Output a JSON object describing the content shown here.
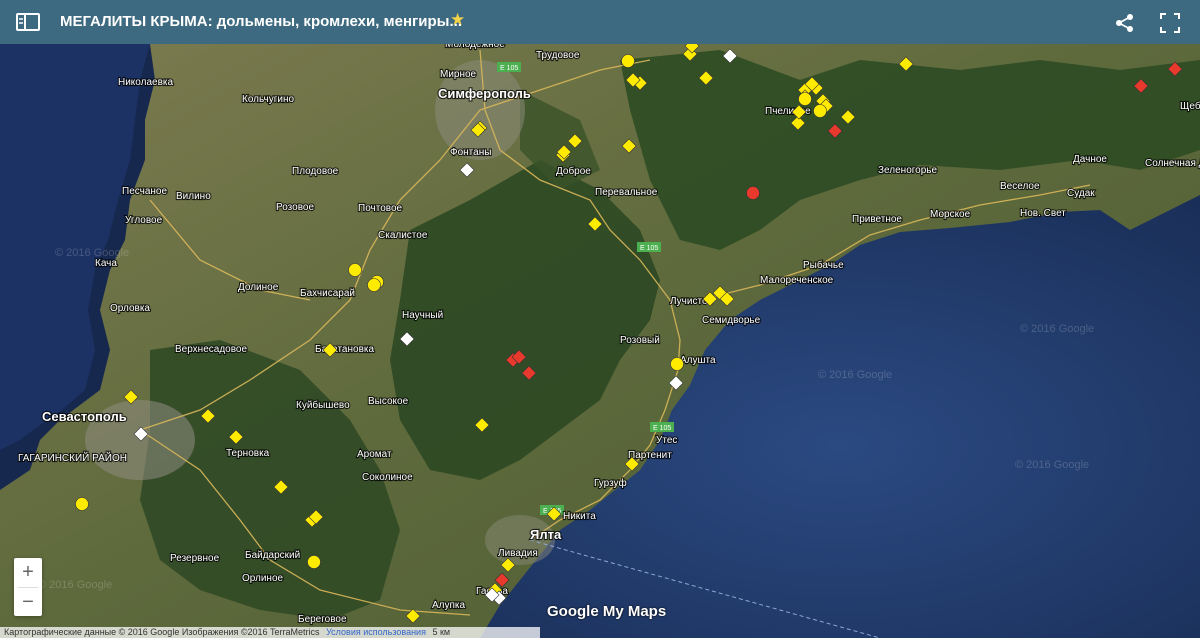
{
  "header": {
    "title": "МЕГАЛИТЫ КРЫМА: дольмены, кромлехи, менгиры...",
    "star": "★",
    "bg_color": "#3d6a80"
  },
  "colors": {
    "sea": "#1f3566",
    "land": "#6a6d44",
    "forest": "#2f4a25",
    "marker_yellow": "#ffeb00",
    "marker_red": "#e8392d",
    "marker_white": "#ffffff"
  },
  "zoom": {
    "plus": "+",
    "minus": "−"
  },
  "attribution": {
    "data": "Картографические данные © 2016 Google Изображения ©2016 TerraMetrics",
    "terms": "Условия использования",
    "scale": "5 км"
  },
  "logo": "Google My Maps",
  "watermarks": [
    "© 2016 Google",
    "© 2016 Google",
    "© 2016 Google",
    "© 2016 Google",
    "© 2016 Google"
  ],
  "places": [
    "Молодёжное",
    "Трудовое",
    "Николаевка",
    "Мирное",
    "Симферополь",
    "Кольчугино",
    "Пчелиное",
    "Щебетовка",
    "Фонтаны",
    "Плодовое",
    "Доброе",
    "Перевальное",
    "Песчаное",
    "Вилино",
    "Зеленогорье",
    "Дачное",
    "Солнечная Долина",
    "Угловое",
    "Розовое",
    "Почтовое",
    "Приветное",
    "Морское",
    "Нов. Свет",
    "Веселое",
    "Судак",
    "Скалистое",
    "Кача",
    "Рыбачье",
    "Долиное",
    "Бахчисарай",
    "Малореченское",
    "Орловка",
    "Научный",
    "Лучистое",
    "Семидворье",
    "Верхнесадовое",
    "Басатановка",
    "Розовый",
    "Алушта",
    "Севастополь",
    "Куйбышево",
    "Высокое",
    "ГАГАРИНСКИЙ РАЙОН",
    "Терновка",
    "Утес",
    "Аромат",
    "Партенит",
    "Соколиное",
    "Гурзуф",
    "Никита",
    "Ялта",
    "Резервное",
    "Байдарский",
    "Ливадия",
    "Орлиное",
    "Береговое",
    "Алупка",
    "Гаспра"
  ],
  "roads": [
    "E 105",
    "E 105",
    "E 105",
    "E 105",
    "E 105"
  ],
  "markers": {
    "yellow_diamonds": 38,
    "yellow_circles": 9,
    "red_diamonds": 7,
    "red_circles": 1,
    "white_diamonds": 7
  }
}
